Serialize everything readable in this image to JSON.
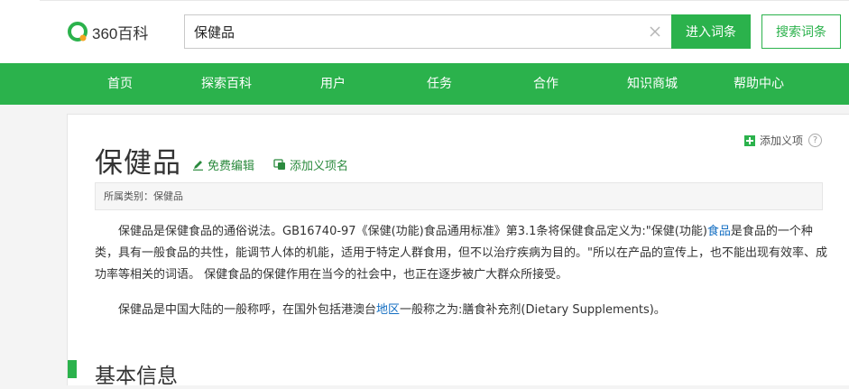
{
  "header": {
    "logo_text": "360百科",
    "search_value": "保健品",
    "enter_button": "进入词条",
    "search_button": "搜索词条"
  },
  "nav": {
    "items": [
      "首页",
      "探索百科",
      "用户",
      "任务",
      "合作",
      "知识商城",
      "帮助中心"
    ]
  },
  "article": {
    "title": "保健品",
    "edit_label": "免费编辑",
    "add_sense_label": "添加义项名",
    "right_add_label": "添加义项",
    "help_symbol": "?",
    "category_prefix": "所属类别：",
    "category_value": "保健品",
    "p1_a": "保健品是保健食品的通俗说法。GB16740-97《保健(功能)食品通用标准》第3.1条将保健食品定义为:\"保健(功能)",
    "p1_link": "食品",
    "p1_b": "是食品的一个种类，具有一般食品的共性，能调节人体的机能，适用于特定人群食用，但不以治疗疾病为目的。\"所以在产品的宣传上，也不能出现有效率、成功率等相关的词语。 保健食品的保健作用在当今的社会中，也正在逐步被广大群众所接受。",
    "p2_a": "保健品是中国大陆的一般称呼，在国外包括港澳台",
    "p2_link": "地区",
    "p2_b": "一般称之为:膳食补充剂(Dietary Supplements)。",
    "section_title": "基本信息"
  },
  "colors": {
    "brand_green": "#2bb24c",
    "link_green": "#2b8a3e",
    "link_blue": "#136ec2"
  },
  "icons": {
    "logo": "logo-icon",
    "clear": "close-icon",
    "edit": "pencil-icon",
    "add_sense": "add-sense-icon",
    "plus": "plus-icon",
    "help": "help-icon"
  }
}
